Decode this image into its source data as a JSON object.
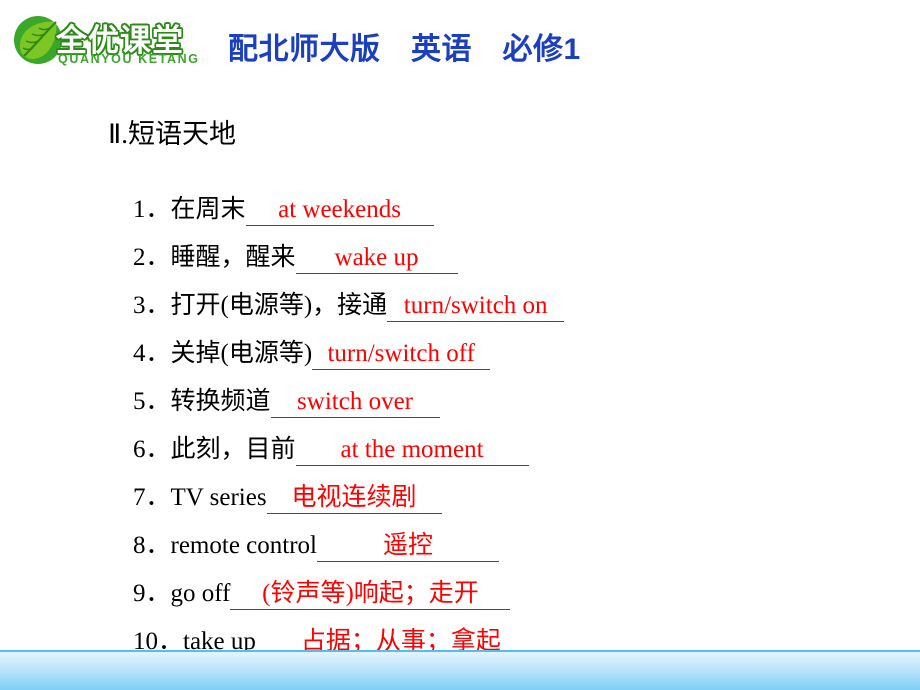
{
  "header": {
    "logo": {
      "main_text": "全优课堂",
      "sub_text": "QUANYOU KETANG",
      "leaf_icon": "leaf-icon",
      "brand_green": "#3aa62a",
      "brand_white": "#ffffff"
    },
    "title": "配北师大版　英语　必修1",
    "title_color": "#1b3fbe"
  },
  "main": {
    "section_title": "Ⅱ.短语天地",
    "answer_color": "#ff0000",
    "items": [
      {
        "num": "1．",
        "prompt": "在周末",
        "answer": "at weekends"
      },
      {
        "num": "2．",
        "prompt": "睡醒，醒来",
        "answer": "wake up"
      },
      {
        "num": "3．",
        "prompt": "打开(电源等)，接通",
        "answer": "turn/switch on"
      },
      {
        "num": "4．",
        "prompt": "关掉(电源等)",
        "answer": "turn/switch off"
      },
      {
        "num": "5．",
        "prompt": "转换频道",
        "answer": "switch over"
      },
      {
        "num": "6．",
        "prompt": "此刻，目前",
        "answer": "at the moment"
      },
      {
        "num": "7．",
        "prompt": "TV series",
        "answer": "电视连续剧"
      },
      {
        "num": "8．",
        "prompt": "remote control",
        "answer": "遥控"
      },
      {
        "num": "9．",
        "prompt": "go off",
        "answer": "(铃声等)响起；走开"
      },
      {
        "num": "10．",
        "prompt": "take up",
        "answer": "占据；从事；拿起"
      }
    ]
  }
}
